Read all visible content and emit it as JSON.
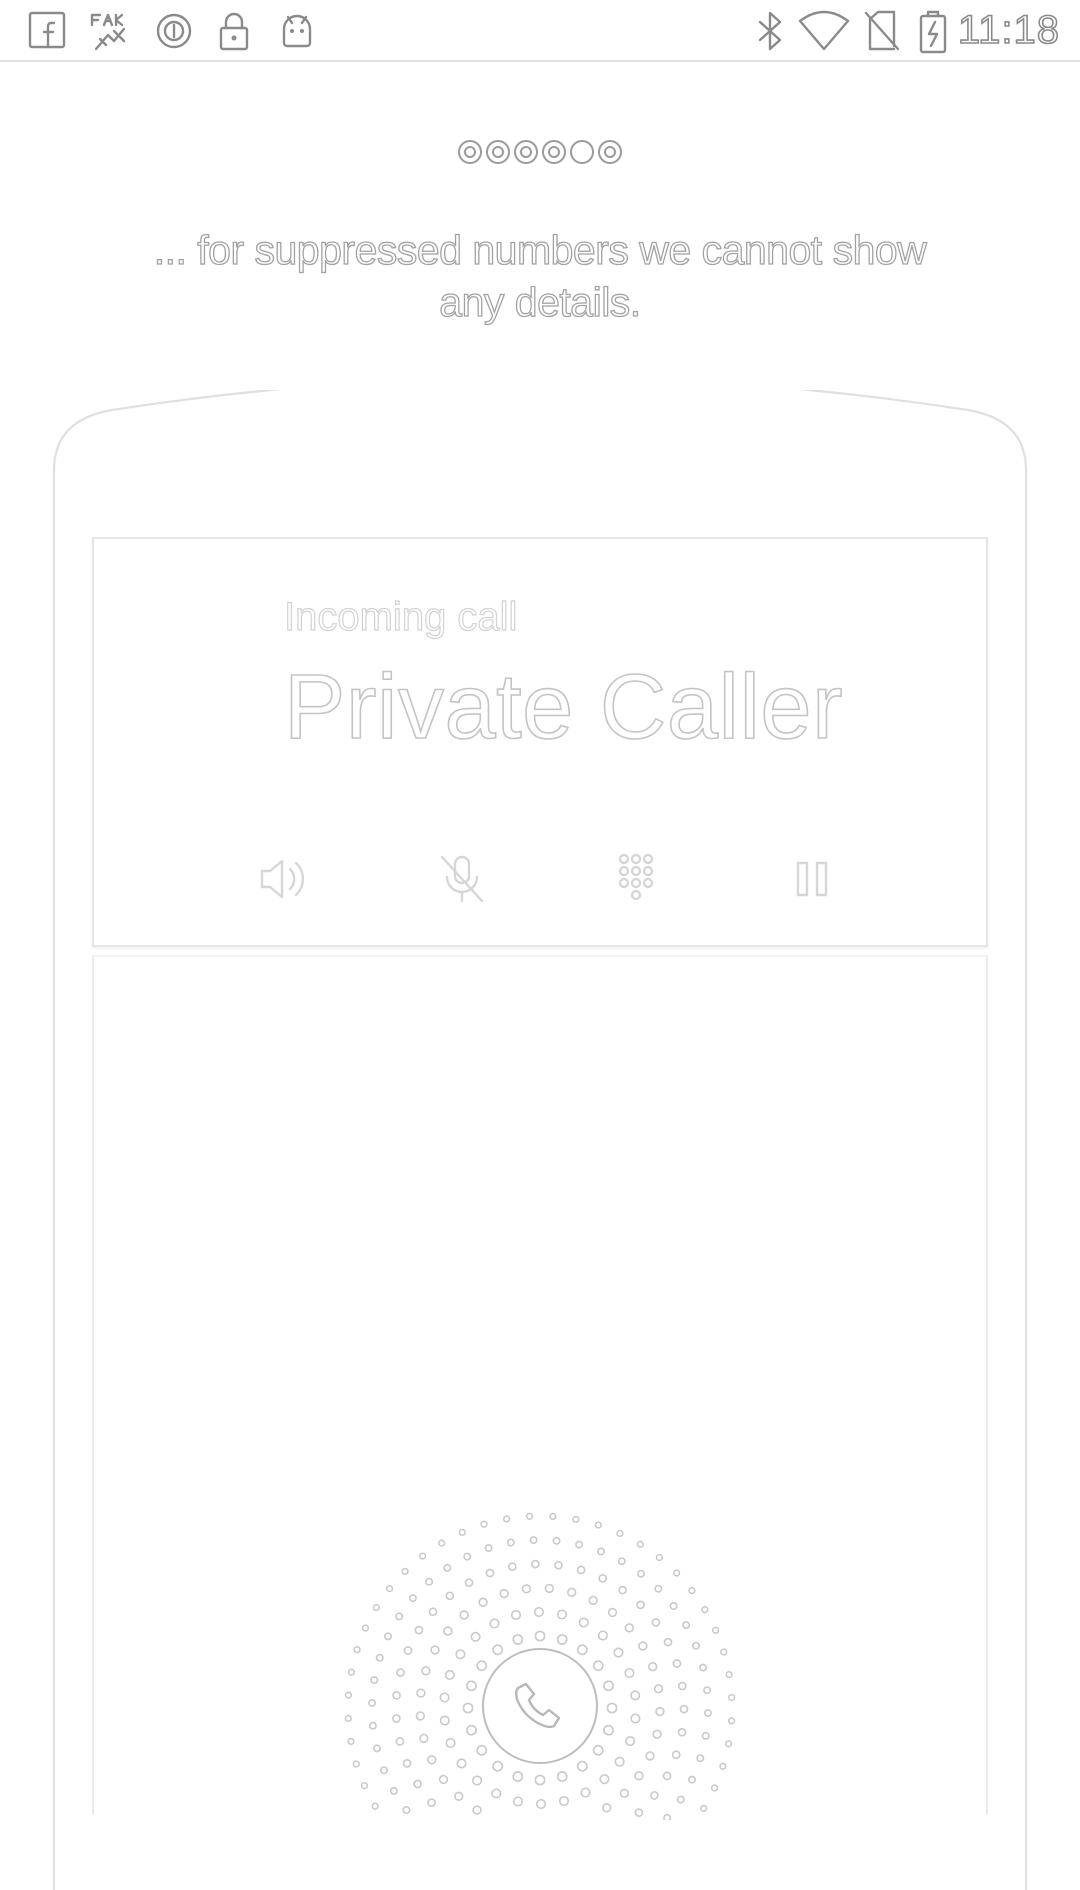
{
  "status_bar": {
    "notification_icons": [
      "facebook-icon",
      "fake-gps-icon",
      "vpn-icon",
      "lock-icon",
      "android-robot-icon"
    ],
    "system_icons": [
      "bluetooth-icon",
      "wifi-icon",
      "no-sim-icon",
      "battery-charging-icon"
    ],
    "time": "11:18"
  },
  "onboarding": {
    "page_count": 6,
    "active_page": 5,
    "description": "... for suppressed numbers we cannot show any details."
  },
  "call_screen": {
    "status": "Incoming call",
    "caller": "Private Caller",
    "actions": [
      "speaker-icon",
      "mute-microphone-icon",
      "dialpad-icon",
      "hold-icon"
    ],
    "answer_icon": "phone-handset-icon"
  }
}
